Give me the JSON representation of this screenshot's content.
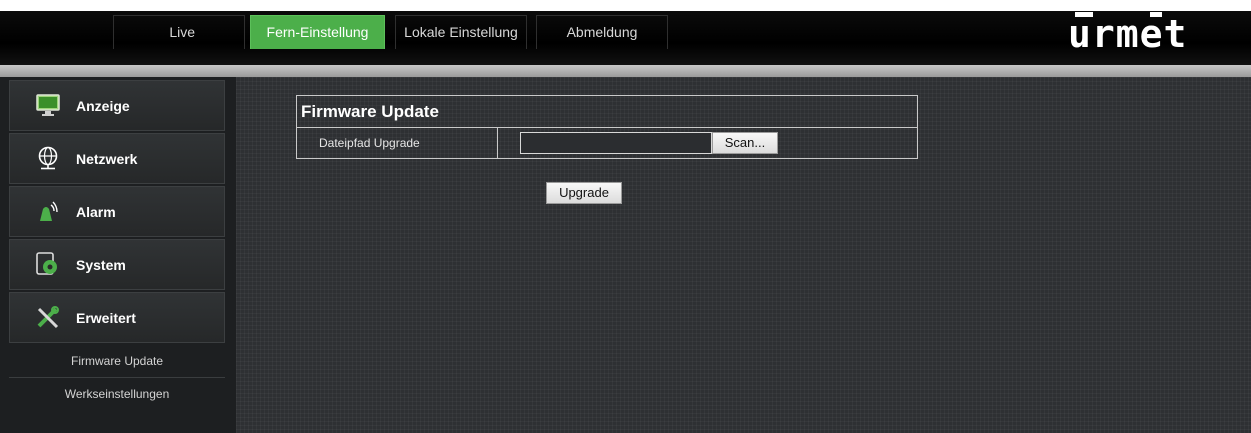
{
  "topnav": {
    "tabs": [
      {
        "label": "Live",
        "active": false
      },
      {
        "label": "Fern-Einstellung",
        "active": true
      },
      {
        "label": "Lokale Einstellung",
        "active": false
      },
      {
        "label": "Abmeldung",
        "active": false
      }
    ],
    "active_color": "#4caf4a"
  },
  "brand": {
    "logo_text": "urmet"
  },
  "sidebar": {
    "items": [
      {
        "label": "Anzeige",
        "icon": "monitor-icon"
      },
      {
        "label": "Netzwerk",
        "icon": "globe-network-icon"
      },
      {
        "label": "Alarm",
        "icon": "alarm-siren-icon"
      },
      {
        "label": "System",
        "icon": "system-gear-icon"
      },
      {
        "label": "Erweitert",
        "icon": "tools-icon"
      }
    ],
    "sub_items": [
      {
        "label": "Firmware Update"
      },
      {
        "label": "Werkseinstellungen"
      }
    ]
  },
  "main": {
    "panel_title": "Firmware Update",
    "path_label": "Dateipfad Upgrade",
    "path_value": "",
    "scan_label": "Scan...",
    "upgrade_label": "Upgrade"
  }
}
